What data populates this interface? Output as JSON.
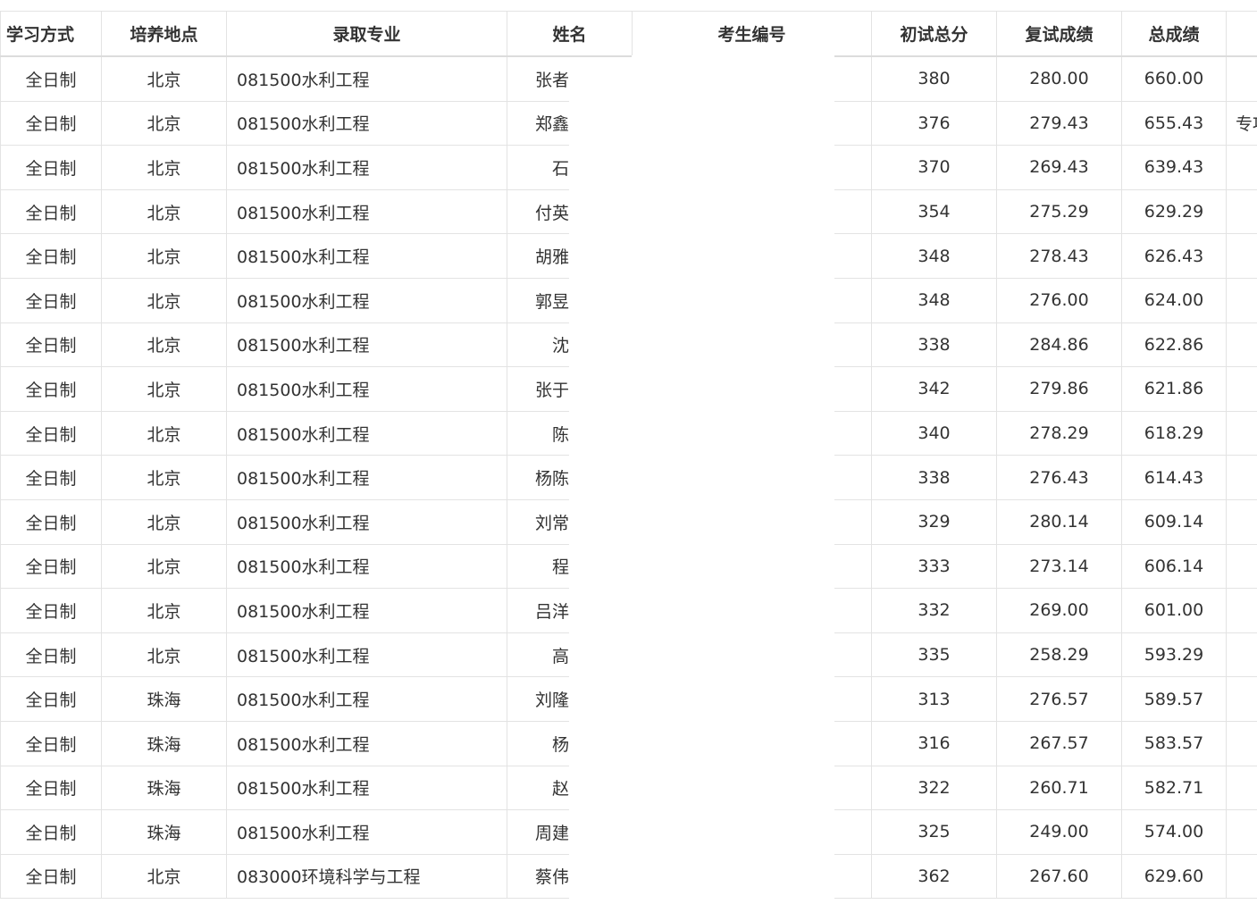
{
  "table": {
    "headers": {
      "mode": "学习方式",
      "location": "培养地点",
      "major": "录取专业",
      "name": "姓名",
      "candidate_id": "考生编号",
      "prelim_total": "初试总分",
      "retest_score": "复试成绩",
      "total_score": "总成绩",
      "note": ""
    },
    "rows": [
      {
        "mode": "全日制",
        "location": "北京",
        "major": "081500水利工程",
        "name": "张者",
        "prelim": "380",
        "retest": "280.00",
        "total": "660.00",
        "note": ""
      },
      {
        "mode": "全日制",
        "location": "北京",
        "major": "081500水利工程",
        "name": "郑鑫",
        "prelim": "376",
        "retest": "279.43",
        "total": "655.43",
        "note": "专项"
      },
      {
        "mode": "全日制",
        "location": "北京",
        "major": "081500水利工程",
        "name": "石",
        "prelim": "370",
        "retest": "269.43",
        "total": "639.43",
        "note": ""
      },
      {
        "mode": "全日制",
        "location": "北京",
        "major": "081500水利工程",
        "name": "付英",
        "prelim": "354",
        "retest": "275.29",
        "total": "629.29",
        "note": ""
      },
      {
        "mode": "全日制",
        "location": "北京",
        "major": "081500水利工程",
        "name": "胡雅",
        "prelim": "348",
        "retest": "278.43",
        "total": "626.43",
        "note": ""
      },
      {
        "mode": "全日制",
        "location": "北京",
        "major": "081500水利工程",
        "name": "郭昱",
        "prelim": "348",
        "retest": "276.00",
        "total": "624.00",
        "note": ""
      },
      {
        "mode": "全日制",
        "location": "北京",
        "major": "081500水利工程",
        "name": "沈",
        "prelim": "338",
        "retest": "284.86",
        "total": "622.86",
        "note": ""
      },
      {
        "mode": "全日制",
        "location": "北京",
        "major": "081500水利工程",
        "name": "张于",
        "prelim": "342",
        "retest": "279.86",
        "total": "621.86",
        "note": ""
      },
      {
        "mode": "全日制",
        "location": "北京",
        "major": "081500水利工程",
        "name": "陈",
        "prelim": "340",
        "retest": "278.29",
        "total": "618.29",
        "note": ""
      },
      {
        "mode": "全日制",
        "location": "北京",
        "major": "081500水利工程",
        "name": "杨陈",
        "prelim": "338",
        "retest": "276.43",
        "total": "614.43",
        "note": ""
      },
      {
        "mode": "全日制",
        "location": "北京",
        "major": "081500水利工程",
        "name": "刘常",
        "prelim": "329",
        "retest": "280.14",
        "total": "609.14",
        "note": ""
      },
      {
        "mode": "全日制",
        "location": "北京",
        "major": "081500水利工程",
        "name": "程",
        "prelim": "333",
        "retest": "273.14",
        "total": "606.14",
        "note": ""
      },
      {
        "mode": "全日制",
        "location": "北京",
        "major": "081500水利工程",
        "name": "吕洋",
        "prelim": "332",
        "retest": "269.00",
        "total": "601.00",
        "note": ""
      },
      {
        "mode": "全日制",
        "location": "北京",
        "major": "081500水利工程",
        "name": "高",
        "prelim": "335",
        "retest": "258.29",
        "total": "593.29",
        "note": ""
      },
      {
        "mode": "全日制",
        "location": "珠海",
        "major": "081500水利工程",
        "name": "刘隆",
        "prelim": "313",
        "retest": "276.57",
        "total": "589.57",
        "note": ""
      },
      {
        "mode": "全日制",
        "location": "珠海",
        "major": "081500水利工程",
        "name": "杨",
        "prelim": "316",
        "retest": "267.57",
        "total": "583.57",
        "note": ""
      },
      {
        "mode": "全日制",
        "location": "珠海",
        "major": "081500水利工程",
        "name": "赵",
        "prelim": "322",
        "retest": "260.71",
        "total": "582.71",
        "note": ""
      },
      {
        "mode": "全日制",
        "location": "珠海",
        "major": "081500水利工程",
        "name": "周建",
        "prelim": "325",
        "retest": "249.00",
        "total": "574.00",
        "note": ""
      },
      {
        "mode": "全日制",
        "location": "北京",
        "major": "083000环境科学与工程",
        "name": "蔡伟",
        "prelim": "362",
        "retest": "267.60",
        "total": "629.60",
        "note": ""
      }
    ]
  }
}
